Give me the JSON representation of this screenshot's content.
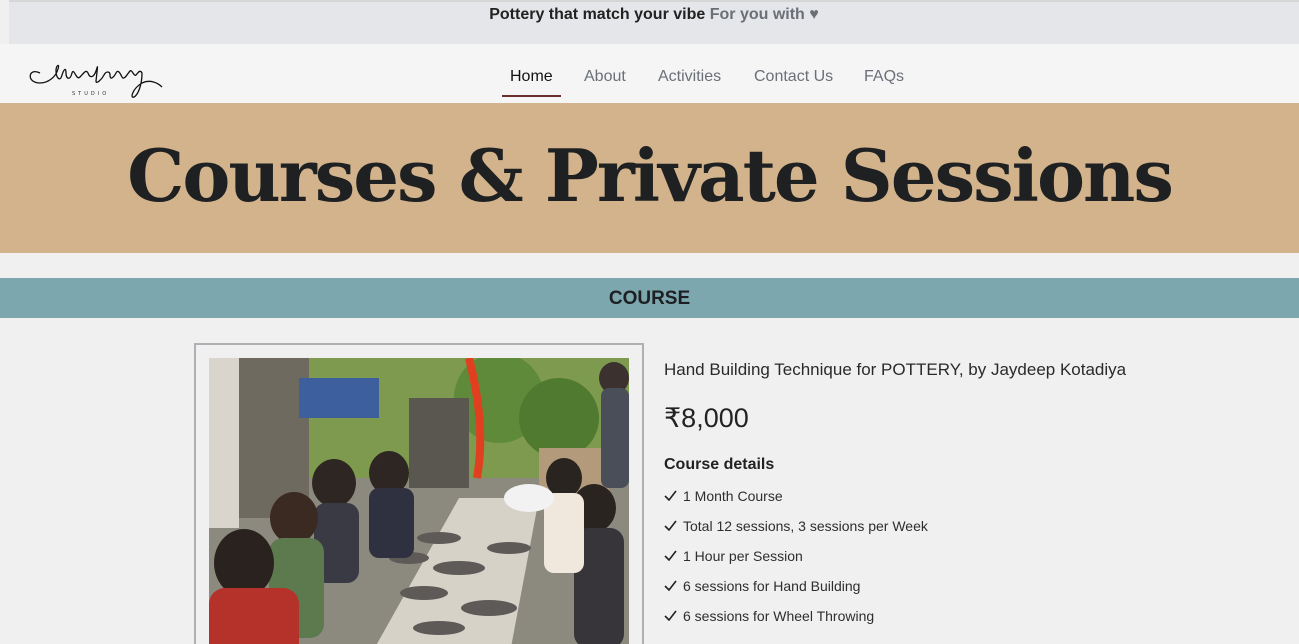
{
  "announcement": {
    "bold_text": "Pottery that match your vibe",
    "accent_text": "For you with",
    "heart_icon": "heart-icon"
  },
  "logo": {
    "alt": "Mudberry Studio"
  },
  "nav": {
    "items": [
      {
        "label": "Home",
        "active": true
      },
      {
        "label": "About",
        "active": false
      },
      {
        "label": "Activities",
        "active": false
      },
      {
        "label": "Contact Us",
        "active": false
      },
      {
        "label": "FAQs",
        "active": false
      }
    ]
  },
  "hero": {
    "title": "Courses & Private Sessions",
    "background": "#d2b38c"
  },
  "section": {
    "title": "COURSE",
    "background": "#7ca7af"
  },
  "course": {
    "title": "Hand Building Technique for POTTERY, by Jaydeep Kotadiya",
    "price": "₹8,000",
    "details_heading": "Course details",
    "details": [
      "1 Month Course",
      "Total 12 sessions, 3 sessions per Week",
      "1 Hour per Session",
      "6 sessions for Hand Building",
      "6 sessions for Wheel Throwing"
    ]
  },
  "colors": {
    "nav_active_underline": "#6a2e2e",
    "topbar": "#e4e6e9"
  }
}
